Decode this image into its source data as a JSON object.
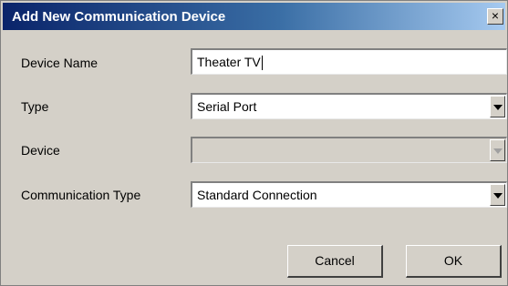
{
  "dialog": {
    "title": "Add New Communication Device",
    "close_label": "×"
  },
  "form": {
    "device_name": {
      "label": "Device Name",
      "value": "Theater TV"
    },
    "type": {
      "label": "Type",
      "value": "Serial Port"
    },
    "device": {
      "label": "Device",
      "value": ""
    },
    "communication_type": {
      "label": "Communication Type",
      "value": "Standard Connection"
    }
  },
  "buttons": {
    "cancel_label": "Cancel",
    "ok_label": "OK"
  },
  "icons": {
    "close": "close-icon",
    "dropdown": "chevron-down-icon"
  }
}
